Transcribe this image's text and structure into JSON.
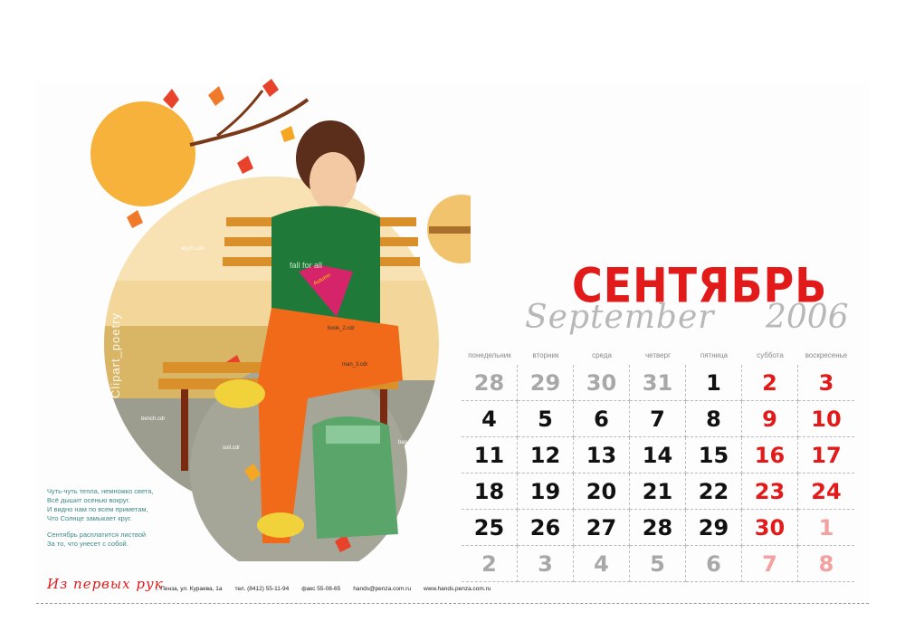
{
  "title": {
    "month_ru": "СЕНТЯБРЬ",
    "month_en": "September",
    "year": "2006"
  },
  "weekdays": [
    "понедельник",
    "вторник",
    "среда",
    "четверг",
    "пятница",
    "суббота",
    "воскресенье"
  ],
  "weeks": [
    [
      "28",
      "29",
      "30",
      "31",
      "1",
      "2",
      "3"
    ],
    [
      "4",
      "5",
      "6",
      "7",
      "8",
      "9",
      "10"
    ],
    [
      "11",
      "12",
      "13",
      "14",
      "15",
      "16",
      "17"
    ],
    [
      "18",
      "19",
      "20",
      "21",
      "22",
      "23",
      "24"
    ],
    [
      "25",
      "26",
      "27",
      "28",
      "29",
      "30",
      "1"
    ],
    [
      "2",
      "3",
      "4",
      "5",
      "6",
      "7",
      "8"
    ]
  ],
  "poem": {
    "lines1": [
      "Чуть-чуть тепла, немножко света,",
      "Всё дышит осенью вокруг.",
      "И видно нам по всем приметам,",
      "Что Солнце замыкает круг."
    ],
    "lines2": [
      "Сентябрь расплатится листвой",
      "За то, что унесет с собой."
    ]
  },
  "logo": "Из первых рук",
  "contacts": {
    "address": "г. Пенза, ул. Кураева, 1а",
    "phone": "тел. (8412) 55-11-94",
    "fax": "факс 55-08-65",
    "email": "hands@penza.com.ru",
    "web": "www.hands.penza.com.ru"
  },
  "illustration": {
    "vertical_text": "Clipart_poetry",
    "shirt_text": "fall for all",
    "book_text": "Autumn",
    "labels": {
      "sky": "sky21.cdr",
      "book": "book_2.cdr",
      "man": "man_3.cdr",
      "bench": "bench.cdr",
      "soil": "soil.cdr",
      "bag": "bag.cdr"
    }
  },
  "colors": {
    "accent_red": "#e21a1a",
    "gray_text": "#a8a8a8",
    "poem_teal": "#3d8a8a"
  }
}
